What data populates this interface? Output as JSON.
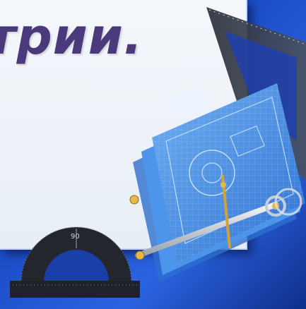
{
  "slide": {
    "title_fragment": "трии.",
    "protractor_mark": "90",
    "colors": {
      "title": "#4a3a7c",
      "frame_blue": "#1c4cc6",
      "panel": "#eef2f8",
      "blueprint": "#3a86e0"
    }
  },
  "icons": [
    "triangle-ruler-icon",
    "blueprint-sheets-icon",
    "compass-icon",
    "protractor-icon"
  ]
}
